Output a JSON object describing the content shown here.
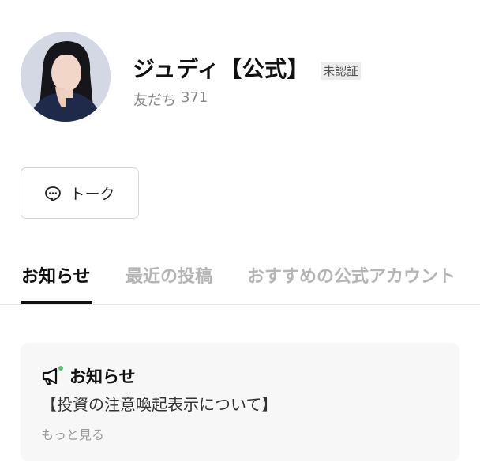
{
  "profile": {
    "name": "ジュディ【公式】",
    "badge": "未認証",
    "friends_label": "友だち",
    "friends_count": "371"
  },
  "talk_button": {
    "label": "トーク",
    "icon": "chat-bubble-icon"
  },
  "tabs": [
    {
      "label": "お知らせ",
      "active": true
    },
    {
      "label": "最近の投稿",
      "active": false
    },
    {
      "label": "おすすめの公式アカウント",
      "active": false
    }
  ],
  "notice": {
    "icon": "megaphone-icon",
    "title": "お知らせ",
    "body": "【投資の注意喚起表示について】",
    "more": "もっと見る"
  },
  "colors": {
    "accent_green": "#4cc764",
    "tab_inactive": "#b5b5b5",
    "card_bg": "#f7f7f7"
  }
}
